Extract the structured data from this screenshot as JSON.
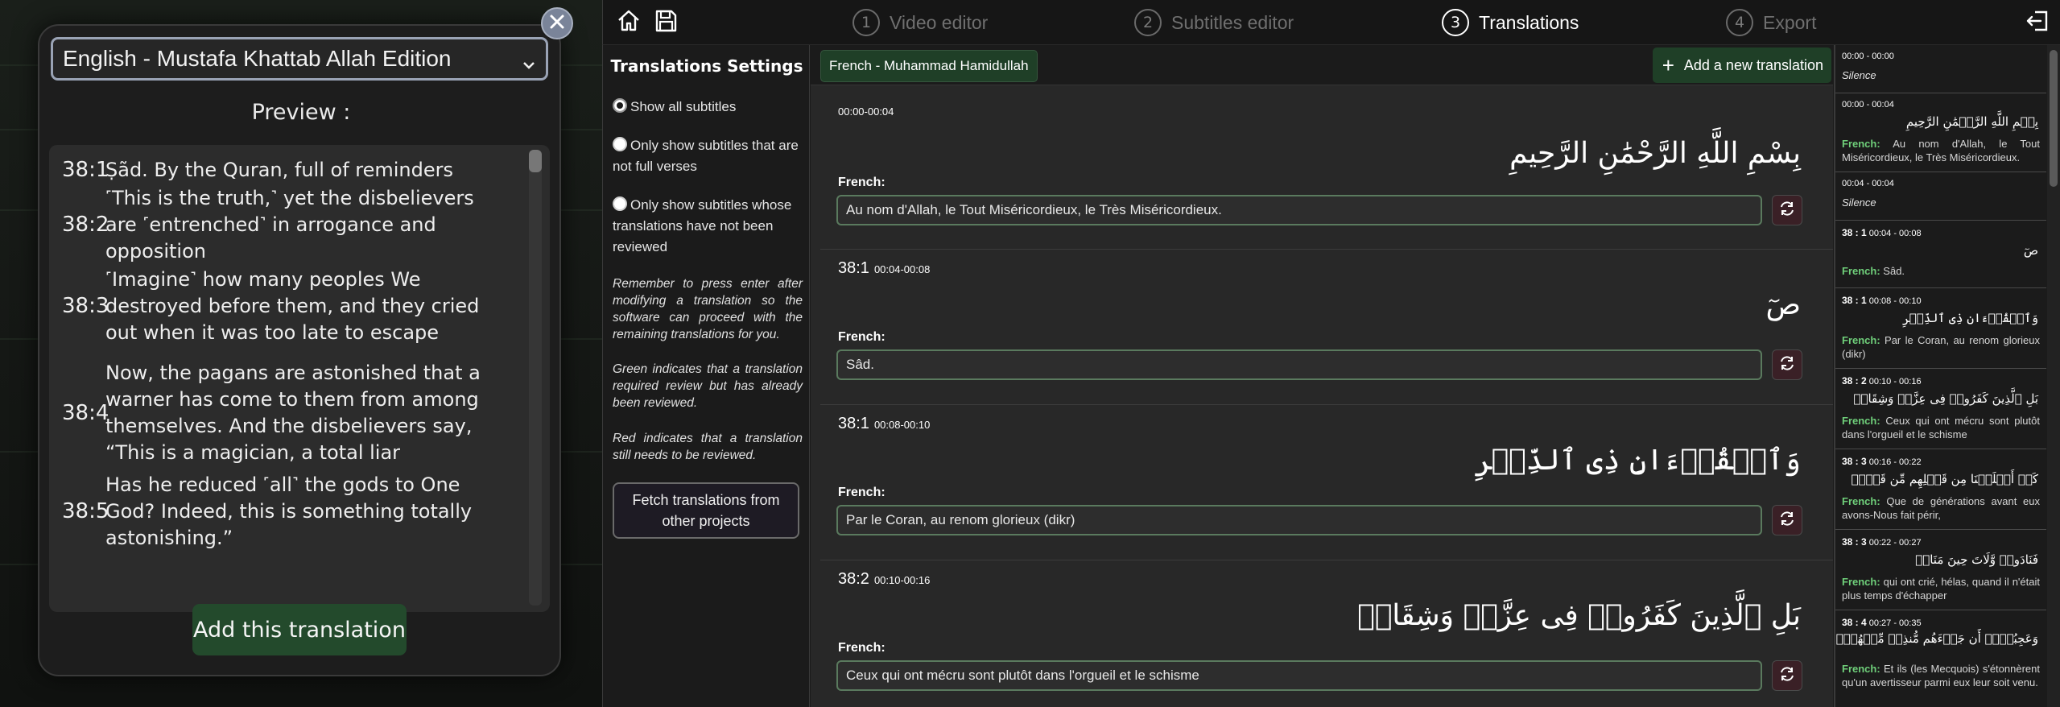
{
  "modal": {
    "selected_translation": "English - Mustafa Khattab Allah Edition",
    "preview_title": "Preview :",
    "preview_items": [
      {
        "ref": "38:1",
        "text": "Ṣãd. By the Quran, full of reminders"
      },
      {
        "ref": "38:2",
        "text": "˹This is the truth,˺ yet the disbelievers are ˹entrenched˺ in arrogance and opposition"
      },
      {
        "ref": "38:3",
        "text": "˹Imagine˺ how many peoples We destroyed before them, and they cried out when it was too late to escape"
      },
      {
        "ref": "38:4",
        "text": "Now, the pagans are astonished that a warner has come to them from among themselves. And the disbelievers say, “This is a magician, a total liar"
      },
      {
        "ref": "38:5",
        "text": "Has he reduced ˹all˺ the gods to One God? Indeed, this is something totally astonishing.”"
      }
    ],
    "add_button": "Add this translation",
    "close_icon": "close-icon"
  },
  "topbar": {
    "steps": [
      {
        "num": "1",
        "label": "Video editor"
      },
      {
        "num": "2",
        "label": "Subtitles editor"
      },
      {
        "num": "3",
        "label": "Translations"
      },
      {
        "num": "4",
        "label": "Export"
      }
    ],
    "active_step": "3",
    "icons": [
      "home-icon",
      "save-icon",
      "exit-icon"
    ]
  },
  "settings": {
    "title": "Translations Settings",
    "options": [
      "Show all subtitles",
      "Only show subtitles that are not full verses",
      "Only show subtitles whose translations have not been reviewed"
    ],
    "selected_option": "Show all subtitles",
    "notes": [
      "Remember to press enter after modifying a translation so the software can proceed with the remaining translations for you.",
      "Green indicates that a translation required review but has already been reviewed.",
      "Red indicates that a translation still needs to be reviewed."
    ],
    "fetch_button": "Fetch translations from other projects"
  },
  "editor": {
    "tab_label": "French - Muhammad Hamidullah",
    "add_new_label": "Add a new translation",
    "field_label": "French:",
    "cards": [
      {
        "ref": "",
        "time": "00:00-00:04",
        "arabic": "بِسْمِ اللَّهِ الرَّحْمَٰنِ الرَّحِيمِ",
        "translation": "Au nom d'Allah, le Tout Miséricordieux, le Très Miséricordieux."
      },
      {
        "ref": "38:1",
        "time": "00:04-00:08",
        "arabic": "صٓ",
        "translation": "Sâd."
      },
      {
        "ref": "38:1",
        "time": "00:08-00:10",
        "arabic": "وَٱلۡقُرۡءَانِ ذِی ٱلذِّكۡرِ",
        "translation": "Par le Coran, au renom glorieux (dikr)"
      },
      {
        "ref": "38:2",
        "time": "00:10-00:16",
        "arabic": "بَلِ ٱلَّذِینَ كَفَرُوا۟ فِی عِزَّةࣲ وَشِقَاقࣲ",
        "translation": "Ceux qui ont mécru sont plutôt dans l'orgueil et le schisme"
      }
    ]
  },
  "right_list": {
    "items": [
      {
        "ref": "",
        "time": "00:00 - 00:00",
        "silence": "Silence"
      },
      {
        "ref": "",
        "time": "00:00 - 00:04",
        "arabic": "بِسۡمِ اللَّهِ الرَّحۡمَٰنِ الرَّحِیمِ",
        "tag": "French:",
        "fr": "Au nom d'Allah, le Tout Miséricordieux, le Très Miséricordieux."
      },
      {
        "ref": "",
        "time": "00:04 - 00:04",
        "silence": "Silence"
      },
      {
        "ref": "38 : 1",
        "time": "00:04 - 00:08",
        "arabic": "صٓ",
        "tag": "French:",
        "fr": "Sâd."
      },
      {
        "ref": "38 : 1",
        "time": "00:08 - 00:10",
        "arabic": "وَٱلۡقُرۡءَانِ ذِی ٱلذِّكۡرِ",
        "tag": "French:",
        "fr": "Par le Coran, au renom glorieux (dikr)"
      },
      {
        "ref": "38 : 2",
        "time": "00:10 - 00:16",
        "arabic": "بَلِ ٱلَّذِینَ كَفَرُوا۟ فِی عِزَّةࣲ وَشِقَاقࣲ",
        "tag": "French:",
        "fr": "Ceux qui ont mécru sont plutôt dans l'orgueil et le schisme"
      },
      {
        "ref": "38 : 3",
        "time": "00:16 - 00:22",
        "arabic": "كَمۡ أَهۡلَكۡنَا مِن قَبۡلِهِم مِّن قَرۡنࣲ",
        "tag": "French:",
        "fr": "Que de générations avant eux avons-Nous fait périr,"
      },
      {
        "ref": "38 : 3",
        "time": "00:22 - 00:27",
        "arabic": "فَنَادَوا۟ وَّلَاتَ حِینَ مَنَاصࣲ",
        "tag": "French:",
        "fr": "qui ont crié, hélas, quand il n'était plus temps d'échapper"
      },
      {
        "ref": "38 : 4",
        "time": "00:27 - 00:35",
        "arabic": "وَعَجِبُوۤا۟ أَن جَاۤءَهُم مُّنذِرࣱ مِّنۡهُمۡۖ",
        "tag": "French:",
        "fr": "Et ils (les Mecquois) s'étonnèrent qu'un avertisseur parmi eux leur soit venu."
      }
    ]
  },
  "colors": {
    "accent_green": "#1f3f27",
    "reviewed_green": "#6fcf7a",
    "needs_review_red": "#3a2026"
  }
}
